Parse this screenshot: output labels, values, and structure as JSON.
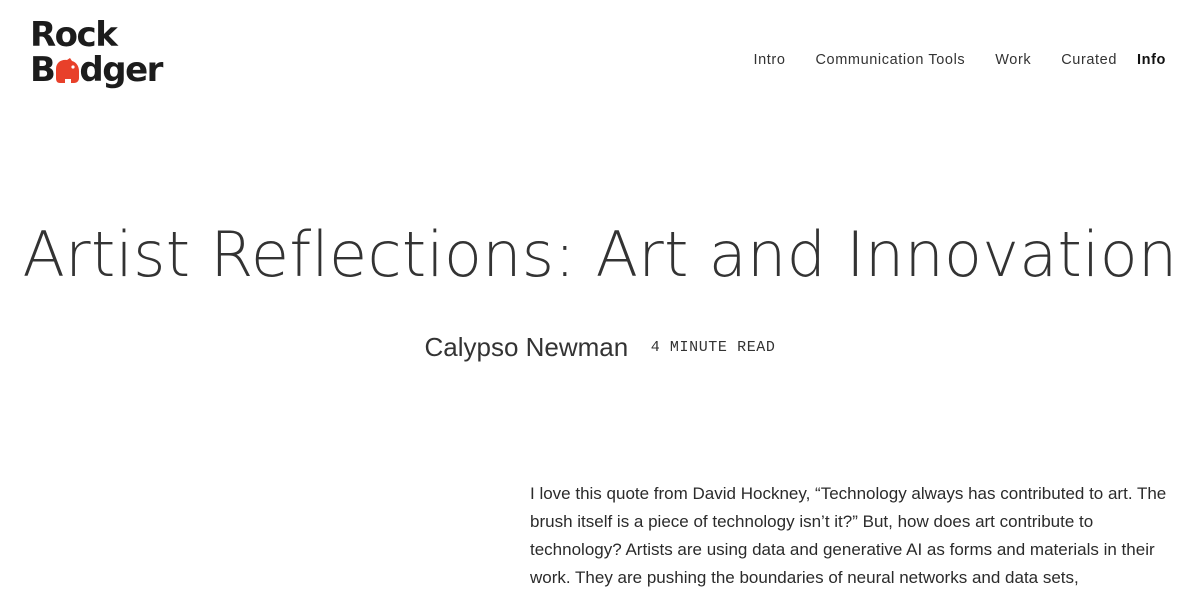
{
  "logo": {
    "line1": "Rock",
    "line2_prefix": "B",
    "line2_suffix": "dger",
    "mark_icon": "badger-icon",
    "accent_color": "#e8402a"
  },
  "nav": {
    "items": [
      {
        "label": "Intro"
      },
      {
        "label": "Communication Tools"
      },
      {
        "label": "Work"
      },
      {
        "label": "Curated"
      },
      {
        "label": "Info"
      }
    ],
    "active_index": 4
  },
  "article": {
    "title": "Artist Reflections: Art and Innovation",
    "author": "Calypso Newman",
    "read_time": "4 MINUTE READ",
    "paragraph": "I love this quote from David Hockney, “Technology always has contributed to art. The brush itself is a piece of technology isn’t it?” But, how does art contribute to technology? Artists are using data and generative AI as forms and materials in their work. They are pushing the boundaries of neural networks and data sets,"
  }
}
